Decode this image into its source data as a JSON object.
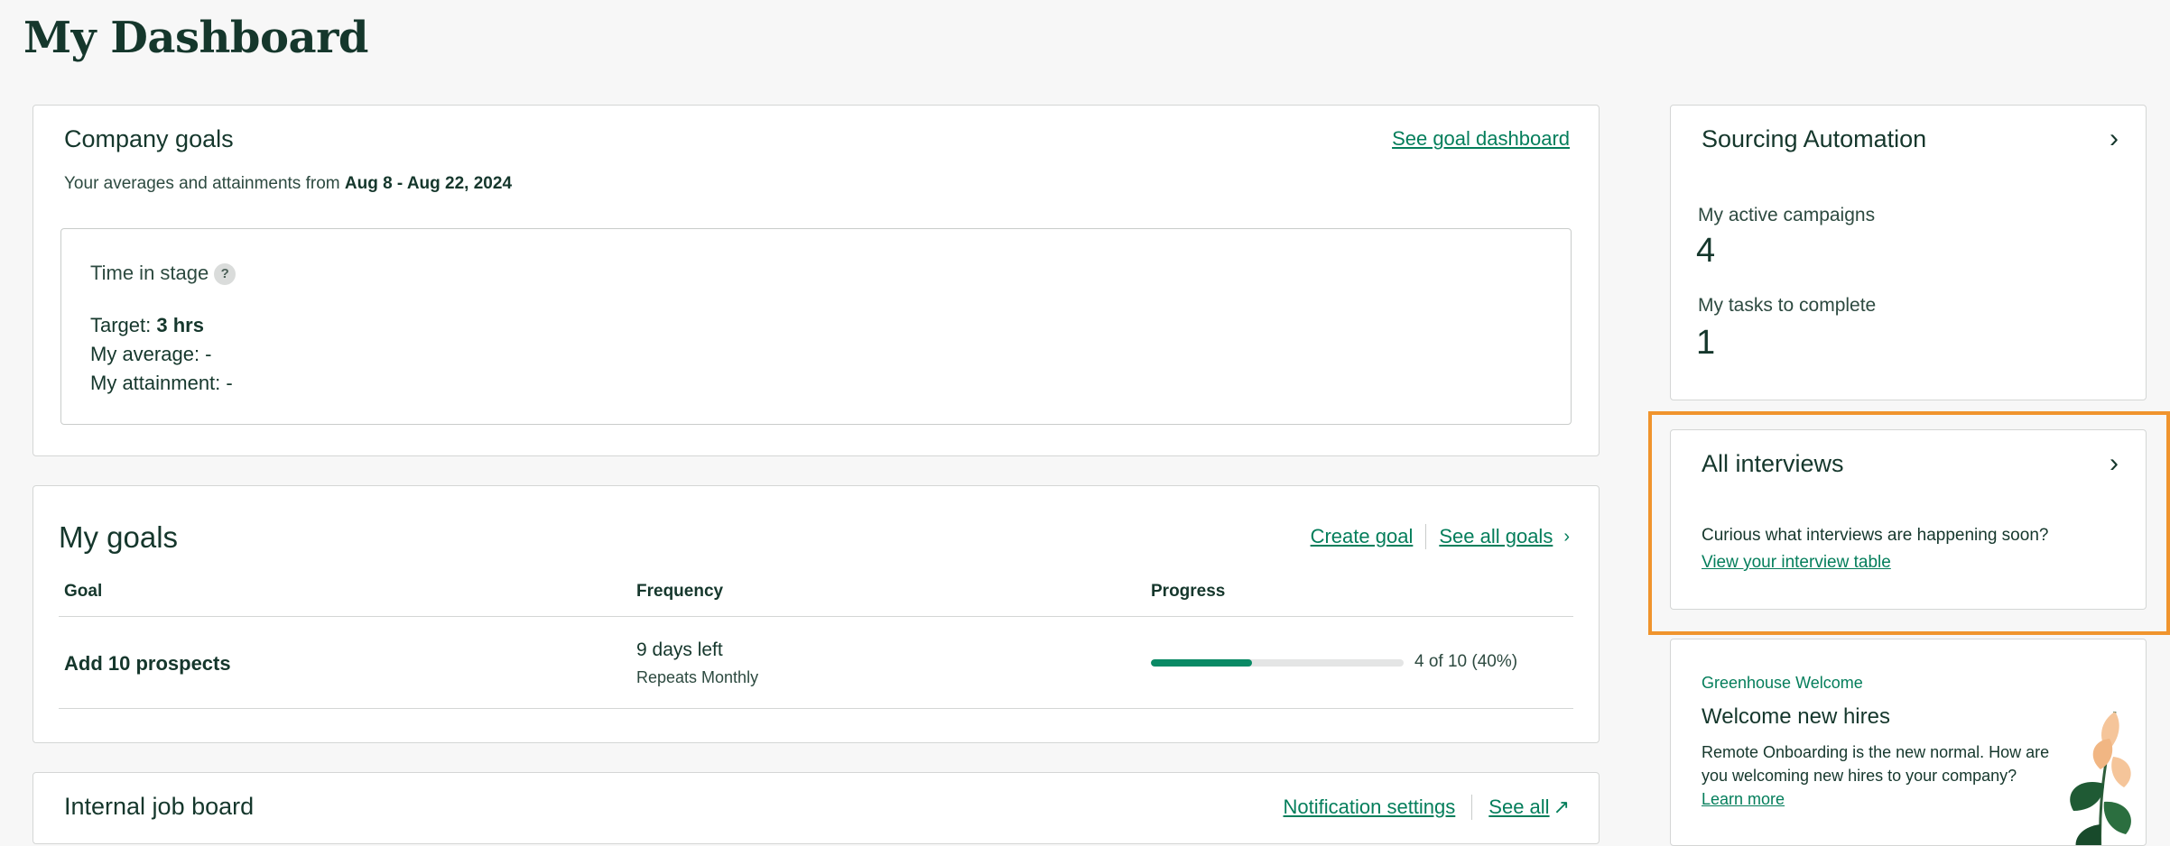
{
  "page": {
    "title": "My Dashboard"
  },
  "company_goals": {
    "title": "Company goals",
    "link": "See goal dashboard",
    "subtitle_prefix": "Your averages and attainments from ",
    "subtitle_range": "Aug 8 - Aug 22, 2024",
    "time_in_stage": {
      "title": "Time in stage",
      "help": "?",
      "target_label": "Target: ",
      "target_value": "3 hrs",
      "average_line": "My average: -",
      "attainment_line": "My attainment: -"
    }
  },
  "my_goals": {
    "title": "My goals",
    "create_link": "Create goal",
    "see_all_link": "See all goals",
    "columns": [
      "Goal",
      "Frequency",
      "Progress"
    ],
    "rows": [
      {
        "goal": "Add 10 prospects",
        "frequency": "9 days left",
        "repeats": "Repeats Monthly",
        "progress_fraction": 0.4,
        "progress_text": "4 of 10 (40%)"
      }
    ]
  },
  "job_board": {
    "title": "Internal job board",
    "notification_link": "Notification settings",
    "see_all_link": "See all",
    "external_icon": "arrow-up-right-icon"
  },
  "sourcing": {
    "title": "Sourcing Automation",
    "campaigns_label": "My active campaigns",
    "campaigns_value": "4",
    "tasks_label": "My tasks to complete",
    "tasks_value": "1"
  },
  "interviews": {
    "title": "All interviews",
    "text": "Curious what interviews are happening soon?",
    "link": "View your interview table"
  },
  "welcome": {
    "eyebrow": "Greenhouse Welcome",
    "title": "Welcome new hires",
    "body": "Remote Onboarding is the new normal. How are you welcoming new hires to your company? ",
    "link": "Learn more"
  },
  "colors": {
    "brand_dark": "#15372c",
    "link_green": "#047e5b",
    "progress_green": "#0a8a65",
    "highlight_orange": "#f0942d"
  }
}
